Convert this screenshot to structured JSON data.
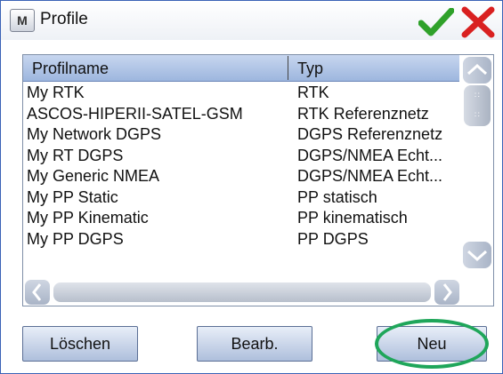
{
  "window": {
    "title": "Profile",
    "menu_icon_text": "M"
  },
  "columns": [
    "Profilname",
    "Typ"
  ],
  "rows": [
    [
      "My RTK",
      "RTK"
    ],
    [
      "ASCOS-HIPERII-SATEL-GSM",
      "RTK Referenznetz"
    ],
    [
      "My Network DGPS",
      "DGPS Referenznetz"
    ],
    [
      "My RT DGPS",
      "DGPS/NMEA Echt..."
    ],
    [
      "My Generic NMEA",
      "DGPS/NMEA Echt..."
    ],
    [
      "My PP Static",
      "PP statisch"
    ],
    [
      "My PP Kinematic",
      "PP kinematisch"
    ],
    [
      "My PP DGPS",
      "PP DGPS"
    ]
  ],
  "buttons": {
    "delete": "Löschen",
    "edit": "Bearb.",
    "new": "Neu"
  },
  "icons": {
    "ok": "checkmark-icon",
    "close": "close-x-icon"
  },
  "colors": {
    "accent": "#3a62b6",
    "ok_green": "#2fa12a",
    "close_red": "#d92020",
    "highlight": "#1fa65a"
  }
}
